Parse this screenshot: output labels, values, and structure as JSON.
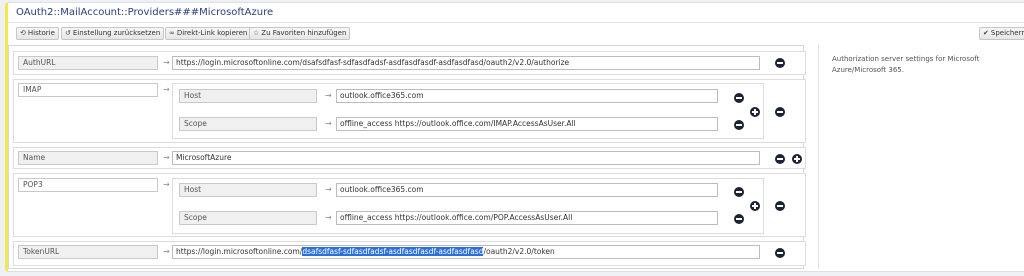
{
  "page": {
    "title": "OAuth2::MailAccount::Providers###MicrosoftAzure"
  },
  "toolbar": {
    "history": "Historie",
    "reset": "Einstellung zurücksetzen",
    "copy_link": "Direkt-Link kopieren",
    "favorite": "Zu Favoriten hinzufügen",
    "save": "Speichern"
  },
  "help": {
    "text": "Authorization server settings for Microsoft Azure/Microsoft 365."
  },
  "settings": {
    "auth_url": {
      "key": "AuthURL",
      "value_prefix": "https://login.microsoftonline.com/dsafsdfasf-sdfasdfadsf-asdfasdfasdf-asdfasdfasd/oauth2/v2.0/authorize"
    },
    "imap": {
      "key": "IMAP",
      "host_key": "Host",
      "host_value": "outlook.office365.com",
      "scope_key": "Scope",
      "scope_value": "offline_access https://outlook.office.com/IMAP.AccessAsUser.All"
    },
    "name": {
      "key": "Name",
      "value": "MicrosoftAzure"
    },
    "pop3": {
      "key": "POP3",
      "host_key": "Host",
      "host_value": "outlook.office365.com",
      "scope_key": "Scope",
      "scope_value": "offline_access https://outlook.office.com/POP.AccessAsUser.All"
    },
    "token_url": {
      "key": "TokenURL",
      "value_prefix": "https://login.microsoftonline.com/",
      "value_selected": "dsafsdfasf-sdfasdfadsf-asdfasdfasdf-asdfasdfasd",
      "value_suffix": "/oauth2/v2.0/token"
    }
  },
  "icons": {
    "history": "history-icon",
    "reset": "reset-icon",
    "link": "link-icon",
    "star": "star-icon",
    "check": "check-icon",
    "arrow": "arrow-right-icon",
    "remove": "minus-circle-icon",
    "add": "plus-circle-icon"
  }
}
